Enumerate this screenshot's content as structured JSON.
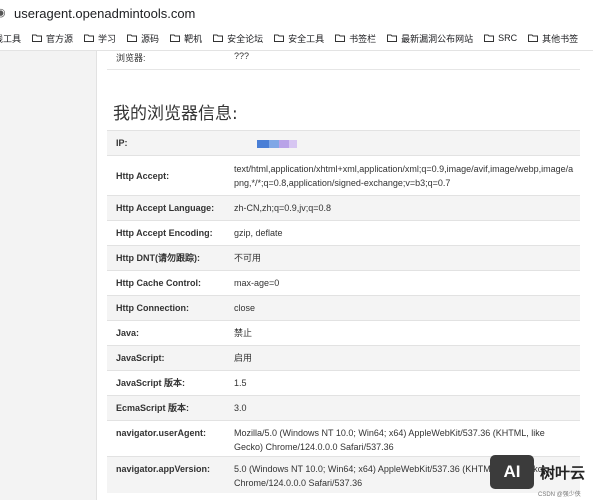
{
  "browser": {
    "url": "useragent.openadmintools.com",
    "bookmarks": [
      "线工具",
      "官方源",
      "学习",
      "源码",
      "靶机",
      "安全论坛",
      "安全工具",
      "书签栏",
      "最新漏洞公布网站",
      "SRC",
      "其他书签"
    ]
  },
  "top_row": {
    "key": "浏览器:",
    "value": "???"
  },
  "section_title": "我的浏览器信息:",
  "rows": [
    {
      "key": "IP:",
      "value": ""
    },
    {
      "key": "Http Accept:",
      "value": "text/html,application/xhtml+xml,application/xml;q=0.9,image/avif,image/webp,image/apng,*/*;q=0.8,application/signed-exchange;v=b3;q=0.7"
    },
    {
      "key": "Http Accept Language:",
      "value": "zh-CN,zh;q=0.9,jv;q=0.8"
    },
    {
      "key": "Http Accept Encoding:",
      "value": "gzip, deflate"
    },
    {
      "key": "Http DNT(请勿跟踪):",
      "value": "不可用"
    },
    {
      "key": "Http Cache Control:",
      "value": "max-age=0"
    },
    {
      "key": "Http Connection:",
      "value": "close"
    },
    {
      "key": "Java:",
      "value": "禁止"
    },
    {
      "key": "JavaScript:",
      "value": "启用"
    },
    {
      "key": "JavaScript 版本:",
      "value": "1.5"
    },
    {
      "key": "EcmaScript 版本:",
      "value": "3.0"
    },
    {
      "key": "navigator.userAgent:",
      "value": "Mozilla/5.0 (Windows NT 10.0; Win64; x64) AppleWebKit/537.36 (KHTML, like Gecko) Chrome/124.0.0.0 Safari/537.36"
    },
    {
      "key": "navigator.appVersion:",
      "value": "5.0 (Windows NT 10.0; Win64; x64) AppleWebKit/537.36 (KHTML, like Gecko) Chrome/124.0.0.0 Safari/537.36"
    }
  ],
  "colors": {
    "ip_mask": [
      "#4a7fd6",
      "#7fa7e6",
      "#b9a3e8",
      "#d7c6f2"
    ]
  },
  "watermark": {
    "logo": "AI",
    "name": "树叶云",
    "credit": "CSDN @强少侠"
  }
}
